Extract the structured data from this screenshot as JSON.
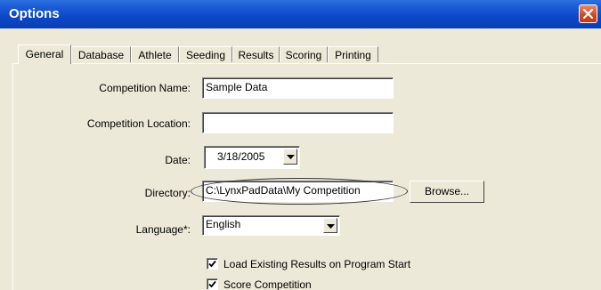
{
  "window": {
    "title": "Options"
  },
  "tabs": [
    "General",
    "Database",
    "Athlete",
    "Seeding",
    "Results",
    "Scoring",
    "Printing"
  ],
  "form": {
    "competition_name": {
      "label": "Competition Name:",
      "value": "Sample Data"
    },
    "competition_location": {
      "label": "Competition Location:",
      "value": ""
    },
    "date": {
      "label": "Date:",
      "value": "3/18/2005"
    },
    "directory": {
      "label": "Directory:",
      "value": "C:\\LynxPadData\\My Competition",
      "browse_label": "Browse..."
    },
    "language": {
      "label": "Language*:",
      "value": "English"
    },
    "load_existing": {
      "label": "Load Existing Results on Program Start",
      "checked": true
    },
    "score_competition": {
      "label": "Score Competition",
      "checked": true
    }
  },
  "icons": {
    "close": "close-icon",
    "dropdown": "chevron-down-icon",
    "check": "checkmark-icon"
  }
}
